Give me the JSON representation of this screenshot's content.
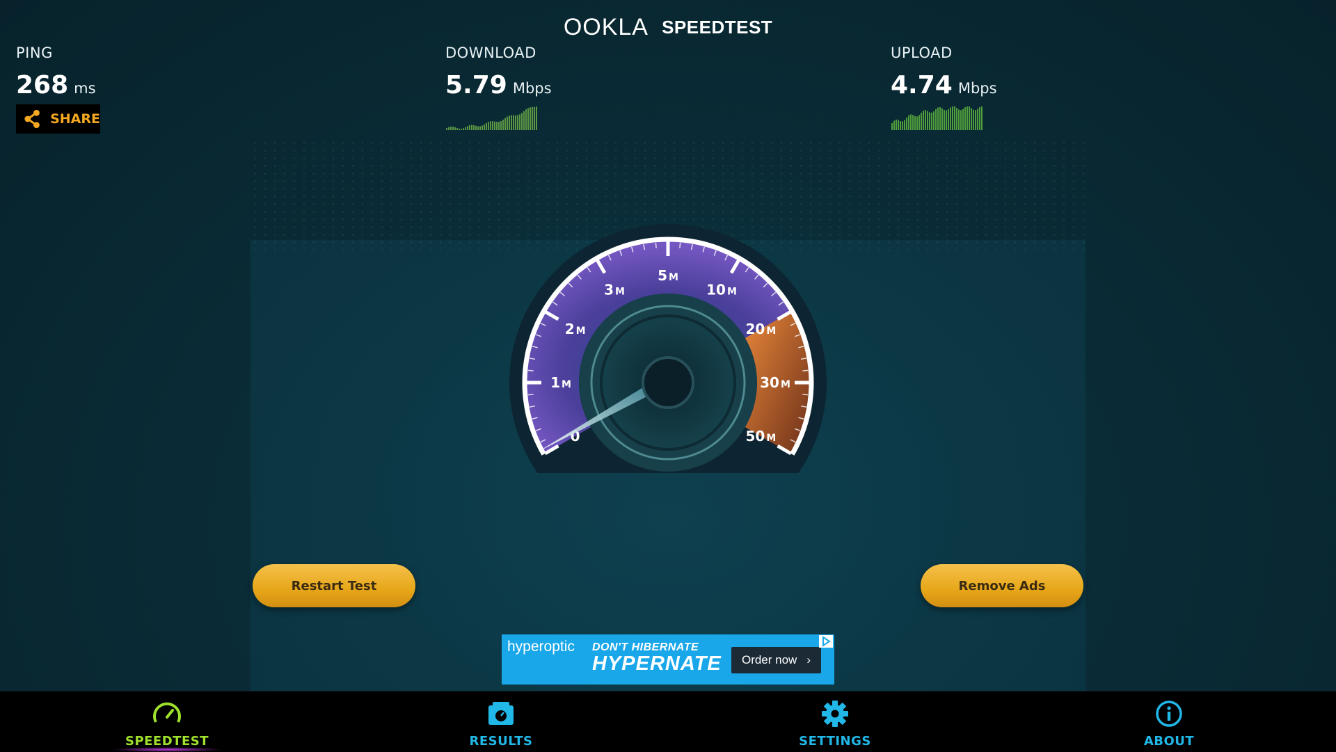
{
  "header": {
    "brand": "OOKLA",
    "product": "SPEEDTEST"
  },
  "ping": {
    "label": "PING",
    "value": "268",
    "unit": "ms"
  },
  "download": {
    "label": "DOWNLOAD",
    "value": "5.79",
    "unit": "Mbps"
  },
  "upload": {
    "label": "UPLOAD",
    "value": "4.74",
    "unit": "Mbps"
  },
  "share_button": {
    "label": "SHARE"
  },
  "gauge": {
    "ticks": [
      "0",
      "1",
      "2",
      "3",
      "5",
      "10",
      "20",
      "30",
      "50"
    ],
    "unit_suffix": "M",
    "needle_value": "0"
  },
  "buttons": {
    "restart": "Restart Test",
    "remove_ads": "Remove Ads"
  },
  "ad": {
    "brand": "hyperoptic",
    "line1": "DON'T HIBERNATE",
    "line2": "HYPERNATE",
    "cta": "Order now"
  },
  "tabs": [
    {
      "label": "SPEEDTEST",
      "icon": "speedometer-icon",
      "active": true
    },
    {
      "label": "RESULTS",
      "icon": "results-icon",
      "active": false
    },
    {
      "label": "SETTINGS",
      "icon": "gear-icon",
      "active": false
    },
    {
      "label": "ABOUT",
      "icon": "info-icon",
      "active": false
    }
  ],
  "colors": {
    "accent_green": "#9fe12c",
    "accent_blue": "#21b8e8",
    "gold": "#e7a619",
    "background": "#0a2c37"
  }
}
